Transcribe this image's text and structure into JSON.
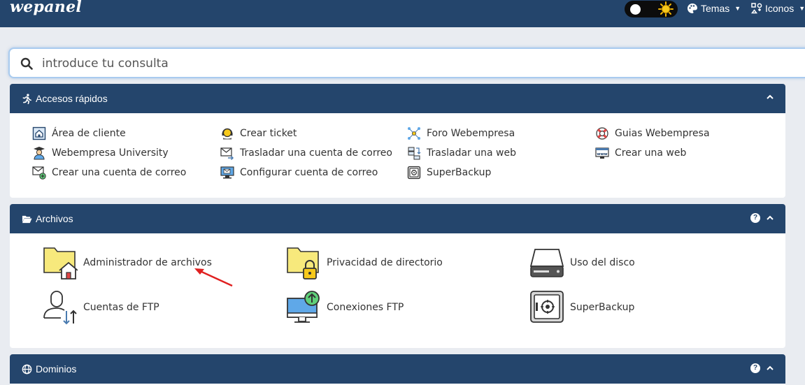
{
  "navbar": {
    "brand": "wepanel",
    "menu_temas": "Temas",
    "menu_iconos": "Iconos"
  },
  "search": {
    "placeholder": "introduce tu consulta"
  },
  "quick_access": {
    "title": "Accesos rápidos",
    "links": [
      {
        "label": "Área de cliente",
        "icon": "home-screen-icon"
      },
      {
        "label": "Crear ticket",
        "icon": "support-agent-icon"
      },
      {
        "label": "Foro Webempresa",
        "icon": "network-icon"
      },
      {
        "label": "Guias Webempresa",
        "icon": "lifebuoy-icon"
      },
      {
        "label": "Webempresa University",
        "icon": "graduate-icon"
      },
      {
        "label": "Trasladar una cuenta de correo",
        "icon": "mail-transfer-icon"
      },
      {
        "label": "Trasladar una web",
        "icon": "server-transfer-icon"
      },
      {
        "label": "Crear una web",
        "icon": "www-icon"
      },
      {
        "label": "Crear una cuenta de correo",
        "icon": "mail-add-icon"
      },
      {
        "label": "Configurar cuenta de correo",
        "icon": "mail-config-icon"
      },
      {
        "label": "SuperBackup",
        "icon": "safe-icon"
      }
    ]
  },
  "files": {
    "title": "Archivos",
    "tools": [
      {
        "label": "Administrador de archivos",
        "icon": "folder-home-icon"
      },
      {
        "label": "Privacidad de directorio",
        "icon": "folder-lock-icon"
      },
      {
        "label": "Uso del disco",
        "icon": "hard-disk-icon"
      },
      {
        "label": "Cuentas de FTP",
        "icon": "user-transfer-icon"
      },
      {
        "label": "Conexiones FTP",
        "icon": "monitor-upload-icon"
      },
      {
        "label": "SuperBackup",
        "icon": "safe-icon"
      }
    ]
  },
  "domains": {
    "title": "Dominios"
  },
  "colors": {
    "header": "#24456c",
    "background": "#e9ecf1",
    "folder_yellow": "#f7e97c",
    "accent_green": "#5fd07a",
    "arrow_red": "#e02020"
  }
}
